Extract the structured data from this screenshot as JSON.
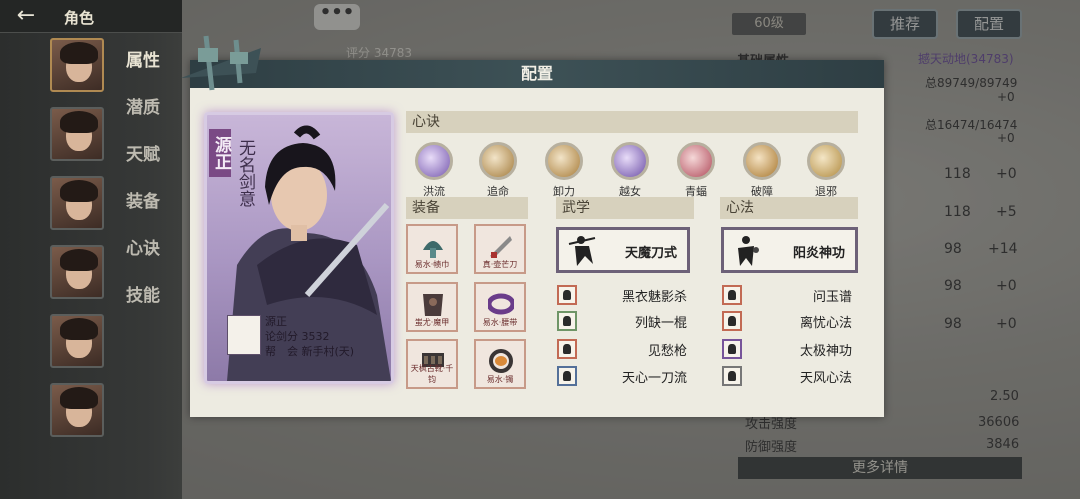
{
  "app": {
    "title": "角色",
    "back_icon": "back-arrow-icon"
  },
  "sidebar": {
    "menu": [
      "属性",
      "潜质",
      "天赋",
      "装备",
      "心诀",
      "技能"
    ]
  },
  "background": {
    "chat_label": "•••",
    "level": "60级",
    "recommend_label": "推荐",
    "config_label": "配置",
    "score": "评分 34783",
    "base_attr_title": "基础属性",
    "base_attr_link": "撼天动地(34783)",
    "stat_rows": [
      {
        "a": "总89749/89749",
        "b": "+0"
      },
      {
        "a": "总16474/16474",
        "b": "+0"
      }
    ],
    "attr_values": [
      {
        "num": "118",
        "delta": "+0"
      },
      {
        "num": "118",
        "delta": "+5"
      },
      {
        "num": "98",
        "delta": "+14"
      },
      {
        "num": "98",
        "delta": "+0"
      },
      {
        "num": "98",
        "delta": "+0"
      }
    ],
    "bottom_stats": [
      {
        "label": "",
        "value": "2.50"
      },
      {
        "label": "攻击强度",
        "value": "36606"
      },
      {
        "label": "防御强度",
        "value": "3846"
      }
    ],
    "more_label": "更多详情"
  },
  "modal": {
    "title": "配置",
    "card": {
      "name": "源正",
      "title": "无名剑意",
      "player": "源正",
      "score_line": "论剑分 3532",
      "guild_line": "帮　会 新手村(天)"
    },
    "xinjue_label": "心诀",
    "xinjue": [
      "洪流",
      "追命",
      "卸力",
      "越女",
      "青蝠",
      "破障",
      "退邪"
    ],
    "equip_label": "装备",
    "equip": [
      {
        "label": "易水·帻巾"
      },
      {
        "label": "真·壶芒刀"
      },
      {
        "label": "蚩尤·魔甲"
      },
      {
        "label": "易水·腰带"
      },
      {
        "label": "天枫古靴·千钧"
      },
      {
        "label": "易水·镯"
      }
    ],
    "wuxue_label": "武学",
    "wuxue_main": "天魔刀式",
    "wuxue": [
      "黑衣魅影杀",
      "列缺一棍",
      "见愁枪",
      "天心一刀流"
    ],
    "xinfa_label": "心法",
    "xinfa_main": "阳炎神功",
    "xinfa": [
      "问玉谱",
      "离忧心法",
      "太极神功",
      "天风心法"
    ],
    "colors": {
      "header": "#3d5156",
      "card_glow": "#ad7ec8"
    }
  }
}
